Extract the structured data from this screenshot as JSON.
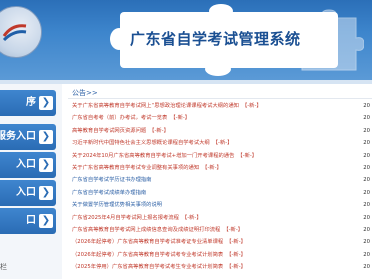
{
  "header": {
    "title": "广东省自学考试管理系统"
  },
  "sidebar": {
    "items": [
      {
        "label": "序"
      },
      {
        "label": "服务入口"
      },
      {
        "label": "入口"
      },
      {
        "label": "入口"
      },
      {
        "label": "口"
      }
    ],
    "footer": "栏"
  },
  "notices": {
    "heading": "公告>>",
    "new_badge": "【-新-】",
    "items": [
      {
        "text": "关于广东省高等教育自学考试网上“思想政治理论课课程考试大纲的通知",
        "new": true,
        "blue": false,
        "date": "20"
      },
      {
        "text": "广东省自考考（前）办考试，考试一览表",
        "new": true,
        "blue": false,
        "date": "20"
      },
      {
        "text": "高等教育自学考试网页资源问题",
        "new": true,
        "blue": false,
        "date": "20"
      },
      {
        "text": "习近平新时代中国特色社会主义思想概论课程自学考试大纲",
        "new": true,
        "blue": false,
        "date": "20"
      },
      {
        "text": "关于2024年10月广东省高等教育自学考试+增加一门开考课程的通告",
        "new": true,
        "blue": false,
        "date": "20"
      },
      {
        "text": "关于广东省高等教育自学考试专业调整有关事项的通知",
        "new": true,
        "blue": false,
        "date": "20"
      },
      {
        "text": "广东省自学考试学历证书办理指南",
        "new": false,
        "blue": true,
        "date": "20"
      },
      {
        "text": "广东省自学考试成绩单办理指南",
        "new": false,
        "blue": true,
        "date": "20"
      },
      {
        "text": "关于做置学历管理优势相关事项的说明",
        "new": false,
        "blue": true,
        "date": "20"
      },
      {
        "text": "广东省2025年4月自学考试网上报名报考流程",
        "new": true,
        "blue": false,
        "date": "20"
      },
      {
        "text": "广东省高等教育自学考试网上成绩信息查询及成绩证明打印流程",
        "new": true,
        "blue": false,
        "date": "20"
      },
      {
        "text": "（2026年起停考）广东省高等教育自学考试准考证专业清单课程",
        "new": true,
        "blue": false,
        "date": "20"
      },
      {
        "text": "（2026年起停考）广东省高等教育自学考试考专业考试计划简表",
        "new": true,
        "blue": false,
        "date": "20"
      },
      {
        "text": "（2025年停用）广东省高等教育自学考试考生专业考试计划简表",
        "new": true,
        "blue": false,
        "date": "20"
      }
    ]
  },
  "colors": {
    "header_blue": "#2b6fb8",
    "sidebar_button": "#2a6cb4",
    "title_text": "#1a4f92",
    "notice_red": "#c0392b",
    "notice_blue": "#2b5fa5"
  },
  "icons": {
    "logo": "exam-logo-icon",
    "puzzle": "puzzle-piece-icon",
    "chevron": "chevron-right-icon"
  }
}
